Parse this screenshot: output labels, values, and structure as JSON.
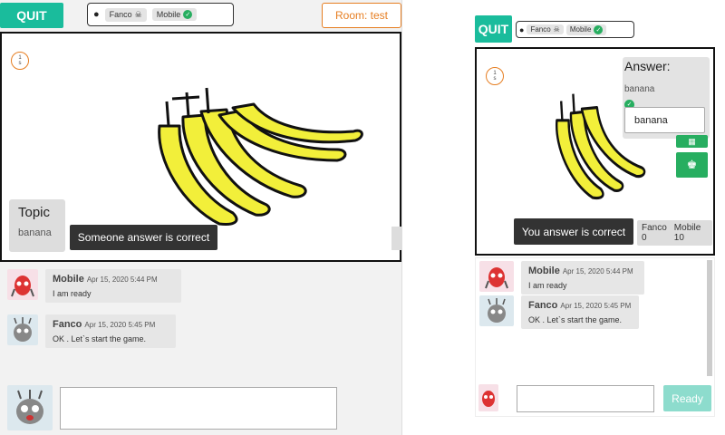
{
  "left": {
    "quit_label": "QUIT",
    "players": [
      {
        "name": "Fanco",
        "status_icon": "ghost-icon"
      },
      {
        "name": "Mobile",
        "status_icon": "check-icon"
      }
    ],
    "room_label": "Room: test",
    "timer": {
      "value": "1",
      "unit": "s"
    },
    "topic": {
      "title": "Topic",
      "value": "banana"
    },
    "toast": "Someone answer is correct",
    "messages": [
      {
        "name": "Mobile",
        "date": "Apr 15, 2020 5:44 PM",
        "text": "I am ready"
      },
      {
        "name": "Fanco",
        "date": "Apr 15, 2020 5:45 PM",
        "text": "OK . Let`s start the game."
      }
    ],
    "chat_input": {
      "value": "",
      "placeholder": ""
    }
  },
  "right": {
    "quit_label": "QUIT",
    "players": [
      {
        "name": "Fanco",
        "status_icon": "ghost-icon"
      },
      {
        "name": "Mobile",
        "status_icon": "check-icon"
      }
    ],
    "timer": {
      "value": "1",
      "unit": "s"
    },
    "answer": {
      "title": "Answer:",
      "text": "banana",
      "input_value": "banana"
    },
    "toast": "You answer is correct",
    "scores": {
      "names": [
        "Fanco",
        "Mobile"
      ],
      "values": [
        "0",
        "10"
      ]
    },
    "messages": [
      {
        "name": "Mobile",
        "date": "Apr 15, 2020 5:44 PM",
        "text": "I am ready"
      },
      {
        "name": "Fanco",
        "date": "Apr 15, 2020 5:45 PM",
        "text": "OK . Let`s start the game."
      }
    ],
    "ready_label": "Ready"
  },
  "colors": {
    "accent": "#1abc9c",
    "green": "#27ae60",
    "orange": "#e67e22",
    "banana": "#f2ef3a"
  }
}
